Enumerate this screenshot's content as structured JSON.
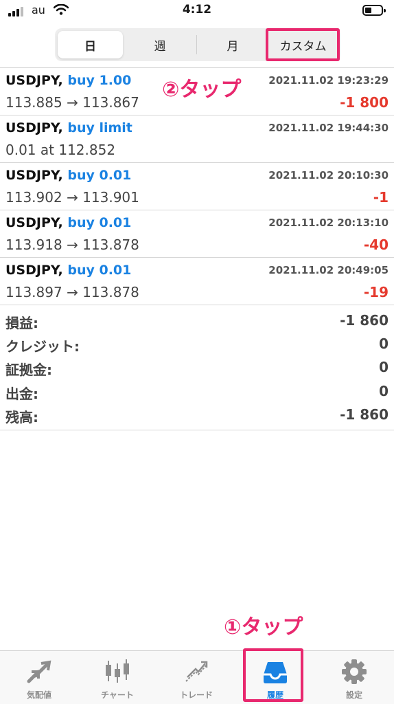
{
  "status_bar": {
    "carrier": "au",
    "time": "4:12"
  },
  "segments": [
    {
      "label": "日",
      "active": true
    },
    {
      "label": "週",
      "active": false
    },
    {
      "label": "月",
      "active": false
    },
    {
      "label": "カスタム",
      "active": false
    }
  ],
  "trades": [
    {
      "symbol": "USDJPY,",
      "side": "buy 1.00",
      "prices": "113.885 → 113.867",
      "time": "2021.11.02 19:23:29",
      "profit": "-1 800"
    },
    {
      "symbol": "USDJPY,",
      "side": "buy limit",
      "prices": "0.01 at 112.852",
      "time": "2021.11.02 19:44:30",
      "profit": ""
    },
    {
      "symbol": "USDJPY,",
      "side": "buy 0.01",
      "prices": "113.902 → 113.901",
      "time": "2021.11.02 20:10:30",
      "profit": "-1"
    },
    {
      "symbol": "USDJPY,",
      "side": "buy 0.01",
      "prices": "113.918 → 113.878",
      "time": "2021.11.02 20:13:10",
      "profit": "-40"
    },
    {
      "symbol": "USDJPY,",
      "side": "buy 0.01",
      "prices": "113.897 → 113.878",
      "time": "2021.11.02 20:49:05",
      "profit": "-19"
    }
  ],
  "summary": [
    {
      "label": "損益:",
      "value": "-1 860"
    },
    {
      "label": "クレジット:",
      "value": "0"
    },
    {
      "label": "証拠金:",
      "value": "0"
    },
    {
      "label": "出金:",
      "value": "0"
    },
    {
      "label": "残高:",
      "value": "-1 860"
    }
  ],
  "annotations": {
    "custom_tap": "②タップ",
    "history_tap": "①タップ"
  },
  "tabs": [
    {
      "label": "気配値",
      "icon": "quotes-arrows-icon",
      "active": false
    },
    {
      "label": "チャート",
      "icon": "candlestick-chart-icon",
      "active": false
    },
    {
      "label": "トレード",
      "icon": "trade-trend-icon",
      "active": false
    },
    {
      "label": "履歴",
      "icon": "history-inbox-icon",
      "active": true
    },
    {
      "label": "設定",
      "icon": "settings-gear-icon",
      "active": false
    }
  ],
  "colors": {
    "accent_blue": "#1a82e2",
    "loss_red": "#e53a2e",
    "annotation_pink": "#e8286e",
    "inactive_gray": "#8e8e8e"
  }
}
